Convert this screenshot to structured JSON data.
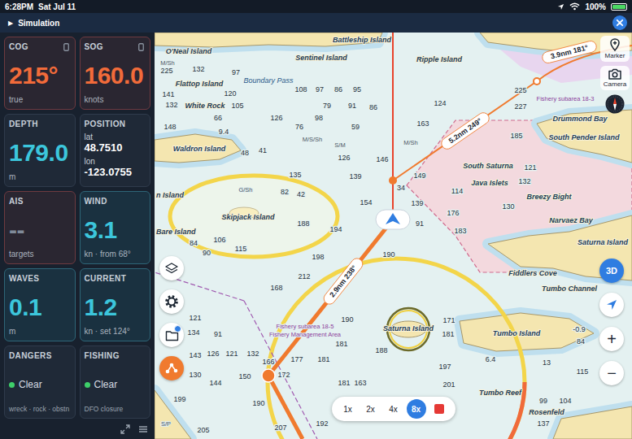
{
  "status_bar": {
    "time": "6:28PM",
    "date": "Sat Jul 11",
    "battery": "100%",
    "battery_level": 1
  },
  "mode_bar": {
    "icon": "▶",
    "title": "Simulation"
  },
  "instruments": [
    {
      "kind": "value",
      "label": "COG",
      "value": "215°",
      "unit": "true",
      "color": "#f26b3a",
      "border": "#6e3a40",
      "background": "#2a2631",
      "pinned": true
    },
    {
      "kind": "value",
      "label": "SOG",
      "value": "160.0",
      "unit": "knots",
      "color": "#f26b3a",
      "border": "#6e3a40",
      "background": "#2a2631",
      "pinned": true
    },
    {
      "kind": "value",
      "label": "DEPTH",
      "value": "179.0",
      "unit": "m",
      "color": "#3cc6dc",
      "border": "#2f3b4c",
      "background": "#1f2937",
      "pinned": false
    },
    {
      "kind": "position",
      "label": "POSITION",
      "lines": [
        {
          "key": "lat",
          "value": "48.7510"
        },
        {
          "key": "lon",
          "value": "-123.0755"
        }
      ],
      "color": "#ffffff",
      "border": "#2f3b4c",
      "background": "#1f2937",
      "pinned": false
    },
    {
      "kind": "value",
      "label": "AIS",
      "value": "--",
      "unit": "targets",
      "color": "#7f8a99",
      "border": "#6e3a40",
      "background": "#2a2631",
      "pinned": false
    },
    {
      "kind": "value",
      "label": "WIND",
      "value": "3.1",
      "unit": "kn · from 68°",
      "color": "#3cc6dc",
      "border": "#2e6678",
      "background": "#1a3140",
      "pinned": false
    },
    {
      "kind": "value",
      "label": "WAVES",
      "value": "0.1",
      "unit": "m",
      "color": "#3cc6dc",
      "border": "#2e6678",
      "background": "#1a3140",
      "pinned": false
    },
    {
      "kind": "value",
      "label": "CURRENT",
      "value": "1.2",
      "unit": "kn · set 124°",
      "color": "#3cc6dc",
      "border": "#2e6678",
      "background": "#1a3140",
      "pinned": false
    },
    {
      "kind": "status",
      "label": "DANGERS",
      "status": "Clear",
      "dot_color": "#3ecf6a",
      "note": "wreck · rock · obstn",
      "color": "#d6dce4",
      "border": "#2f3b4c",
      "background": "#1f2937",
      "pinned": false
    },
    {
      "kind": "status",
      "label": "FISHING",
      "status": "Clear",
      "dot_color": "#3ecf6a",
      "note": "DFO closure",
      "color": "#d6dce4",
      "border": "#2f3b4c",
      "background": "#1f2937",
      "pinned": false
    }
  ],
  "chart": {
    "places": [
      "Battleship Island",
      "O'Neal Island",
      "Sentinel Island",
      "Ripple Island",
      "Flattop Island",
      "White Rock",
      "Waldron Island",
      "n Island",
      "Skipjack Island",
      "Bare Island",
      "Drummond Bay",
      "South Pender Island",
      "South Saturna",
      "Java Islets",
      "Breezy Bight",
      "Narvaez Bay",
      "Saturna Island",
      "Fiddlers Cove",
      "Tumbo Channel",
      "Saturna Island",
      "Tumbo Island",
      "Tumbo Reef",
      "Rosenfeld"
    ],
    "areas": [
      {
        "text": "Boundary Pass",
        "kind": "water"
      },
      {
        "text": "Fishery subarea 18-5",
        "kind": "zone"
      },
      {
        "text": "Fishery Management Area",
        "kind": "zone"
      },
      {
        "text": "Fishery subarea 18-3",
        "kind": "zone"
      }
    ],
    "seabed": [
      "M/Sh",
      "M/S/Sh",
      "S/M",
      "M/Sh",
      "G/Sh",
      "S/P"
    ],
    "soundings": [
      "225",
      "132",
      "97",
      "141",
      "120",
      "108",
      "97",
      "86",
      "95",
      "132",
      "105",
      "79",
      "91",
      "86",
      "98",
      "126",
      "76",
      "59",
      "148",
      "66",
      "9.4",
      "126",
      "146",
      "48",
      "41",
      "135",
      "139",
      "34",
      "82",
      "42",
      "154",
      "188",
      "194",
      "106",
      "84",
      "90",
      "115",
      "198",
      "190",
      "212",
      "168",
      "166",
      "121",
      "134",
      "91",
      "190",
      "181",
      "126",
      "121",
      "132",
      "177",
      "181",
      "188",
      "143",
      "130",
      "144",
      "150",
      "172",
      "181",
      "163",
      "199",
      "190",
      "205",
      "207",
      "192",
      "163",
      "124",
      "149",
      "139",
      "91",
      "114",
      "176",
      "183",
      "185",
      "121",
      "132",
      "130",
      "225",
      "227",
      "171",
      "181",
      "197",
      "201",
      "99",
      "104",
      "137",
      "115",
      "84",
      "6.4",
      "-0.9",
      "13"
    ],
    "routes": [
      {
        "label": "5.2nm 249°"
      },
      {
        "label": "3.9nm 181°"
      },
      {
        "label": "2.9nm 238°"
      }
    ]
  },
  "map_tools": {
    "marker": "Marker",
    "camera": "Camera",
    "view": "3D",
    "zoom_in": "+",
    "zoom_out": "−",
    "files_badge": true
  },
  "playback": {
    "speeds": [
      {
        "label": "1x",
        "selected": false
      },
      {
        "label": "2x",
        "selected": false
      },
      {
        "label": "4x",
        "selected": false
      },
      {
        "label": "8x",
        "selected": true
      }
    ]
  }
}
